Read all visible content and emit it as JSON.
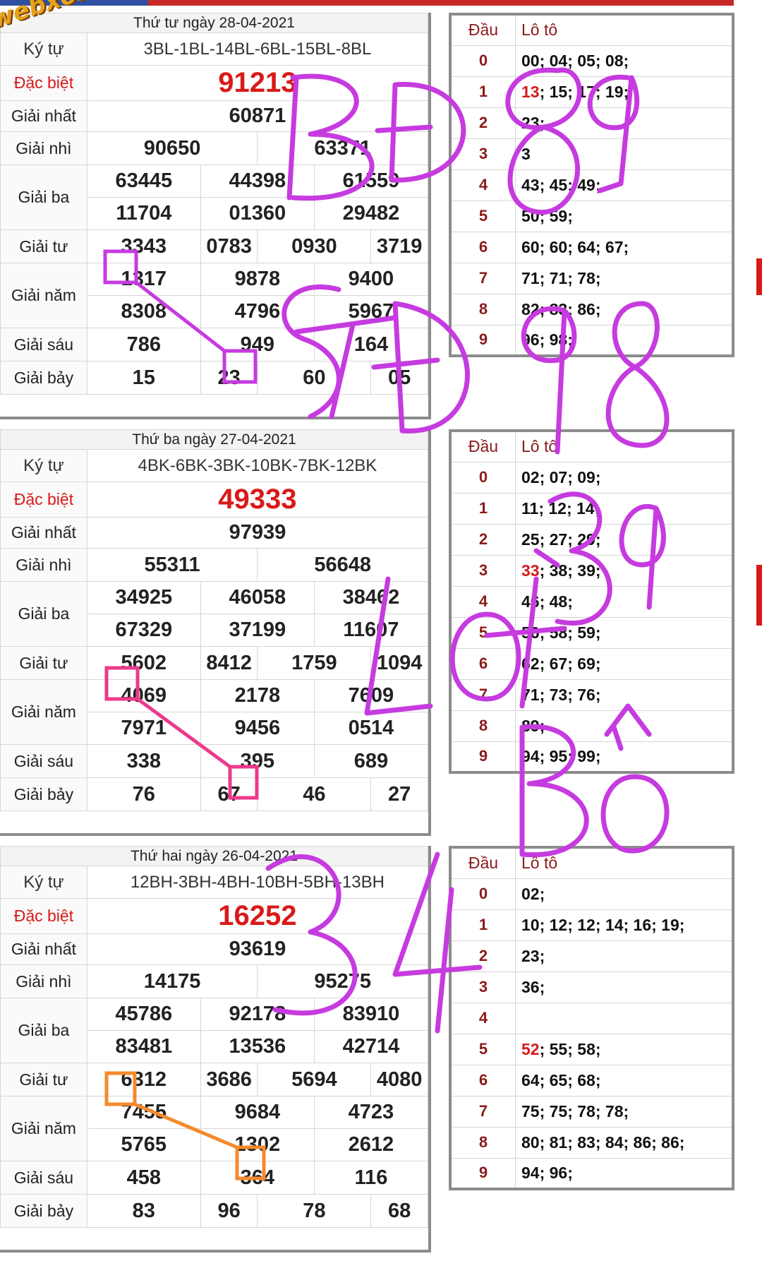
{
  "brand": {
    "watermark": "webxoso.net"
  },
  "colors": {
    "special": "#d81a1a",
    "purple_ink": "#c63bdf",
    "pink_ink": "#ec3a8b",
    "orange_ink": "#f58a2c"
  },
  "labels": {
    "ky_tu": "Ký tự",
    "dac_biet": "Đặc biệt",
    "giai_nhat": "Giải nhất",
    "giai_nhi": "Giải nhì",
    "giai_ba": "Giải ba",
    "giai_tu": "Giải tư",
    "giai_nam": "Giải năm",
    "giai_sau": "Giải sáu",
    "giai_bay": "Giải bảy",
    "dau": "Đầu",
    "loto": "Lô tô"
  },
  "draws": [
    {
      "title": "Thứ tư ngày 28-04-2021",
      "code": "3BL-1BL-14BL-6BL-15BL-8BL",
      "special": "91213",
      "first": "60871",
      "second": [
        "90650",
        "63371"
      ],
      "third": [
        "63445",
        "44398",
        "61559",
        "11704",
        "01360",
        "29482"
      ],
      "fourth": [
        "3343",
        "0783",
        "0930",
        "3719"
      ],
      "fifth": [
        "1317",
        "9878",
        "9400",
        "8308",
        "4796",
        "5967"
      ],
      "sixth": [
        "786",
        "949",
        "164"
      ],
      "seventh": [
        "15",
        "23",
        "60",
        "05"
      ],
      "loto": [
        {
          "d": "0",
          "v": "00; 04; 05; 08;"
        },
        {
          "d": "1",
          "v": "13; 15; 17; 19;",
          "hl": "13"
        },
        {
          "d": "2",
          "v": "23;"
        },
        {
          "d": "3",
          "v": "3"
        },
        {
          "d": "4",
          "v": "43; 45; 49;"
        },
        {
          "d": "5",
          "v": "50; 59;"
        },
        {
          "d": "6",
          "v": "60; 60; 64; 67;"
        },
        {
          "d": "7",
          "v": "71; 71; 78;"
        },
        {
          "d": "8",
          "v": "82; 83; 86;"
        },
        {
          "d": "9",
          "v": "96; 98;"
        }
      ]
    },
    {
      "title": "Thứ ba ngày 27-04-2021",
      "code": "4BK-6BK-3BK-10BK-7BK-12BK",
      "special": "49333",
      "first": "97939",
      "second": [
        "55311",
        "56648"
      ],
      "third": [
        "34925",
        "46058",
        "38462",
        "67329",
        "37199",
        "11607"
      ],
      "fourth": [
        "5602",
        "8412",
        "1759",
        "1094"
      ],
      "fifth": [
        "4069",
        "2178",
        "7609",
        "7971",
        "9456",
        "0514"
      ],
      "sixth": [
        "338",
        "395",
        "689"
      ],
      "seventh": [
        "76",
        "67",
        "46",
        "27"
      ],
      "loto": [
        {
          "d": "0",
          "v": "02; 07; 09;"
        },
        {
          "d": "1",
          "v": "11; 12; 14;"
        },
        {
          "d": "2",
          "v": "25; 27; 29;"
        },
        {
          "d": "3",
          "v": "33; 38; 39;",
          "hl": "33"
        },
        {
          "d": "4",
          "v": "46; 48;"
        },
        {
          "d": "5",
          "v": "56; 58; 59;"
        },
        {
          "d": "6",
          "v": "62; 67; 69;"
        },
        {
          "d": "7",
          "v": "71; 73; 76;"
        },
        {
          "d": "8",
          "v": "89;"
        },
        {
          "d": "9",
          "v": "94; 95; 99;"
        }
      ]
    },
    {
      "title": "Thứ hai ngày 26-04-2021",
      "code": "12BH-3BH-4BH-10BH-5BH-13BH",
      "special": "16252",
      "first": "93619",
      "second": [
        "14175",
        "95275"
      ],
      "third": [
        "45786",
        "92178",
        "83910",
        "83481",
        "13536",
        "42714"
      ],
      "fourth": [
        "6312",
        "3686",
        "5694",
        "4080"
      ],
      "fifth": [
        "7455",
        "9684",
        "4723",
        "5765",
        "1302",
        "2612"
      ],
      "sixth": [
        "458",
        "364",
        "116"
      ],
      "seventh": [
        "83",
        "96",
        "78",
        "68"
      ],
      "loto": [
        {
          "d": "0",
          "v": "02;"
        },
        {
          "d": "1",
          "v": "10; 12; 12; 14; 16; 19;"
        },
        {
          "d": "2",
          "v": "23;"
        },
        {
          "d": "3",
          "v": "36;"
        },
        {
          "d": "4",
          "v": ""
        },
        {
          "d": "5",
          "v": "52; 55; 58;",
          "hl": "52"
        },
        {
          "d": "6",
          "v": "64; 65; 68;"
        },
        {
          "d": "7",
          "v": "75; 75; 78; 78;"
        },
        {
          "d": "8",
          "v": "80; 81; 83; 84; 86; 86;"
        },
        {
          "d": "9",
          "v": "94; 96;"
        }
      ]
    }
  ],
  "handwriting": {
    "line1": "BĐ89",
    "line2": "STĐ98",
    "line3": "39",
    "line4": "Lót",
    "line5": "Bố",
    "line6": "34"
  }
}
